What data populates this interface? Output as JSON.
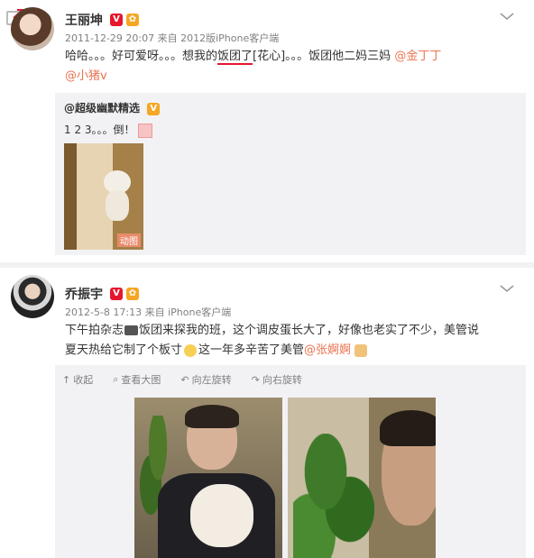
{
  "post1": {
    "author": "王丽坤",
    "meta": "2011-12-29 20:07 来自 2012版iPhone客户端",
    "text_a": "哈哈。。。好可爱呀。。。想我的",
    "text_underlined": "饭团了",
    "text_b": "[花心]。。。饭团他二妈三妈 ",
    "mention_1": "@金丁丁",
    "mention_2": "@小猪v",
    "repost": {
      "author": "@超级幽默精选",
      "text": "1 2 3。。。倒！",
      "gif_label": "动图"
    }
  },
  "post2": {
    "author": "乔振宇",
    "meta": "2012-5-8 17:13 来自 iPhone客户端",
    "line1_a": "下午拍杂志",
    "line1_b": "饭团来探我的班，这个调皮蛋长大了，好像也老实了不少，美管说",
    "line2_a": "夏天热给它制了个板寸",
    "line2_b": "这一年多辛苦了美管",
    "mention": "@张婀婀",
    "toolbar": {
      "collapse": "收起",
      "view_large": "查看大图",
      "rotate_left": "向左旋转",
      "rotate_right": "向右旋转"
    }
  },
  "colors": {
    "link": "#eb7350",
    "underline": "#e6162d"
  }
}
